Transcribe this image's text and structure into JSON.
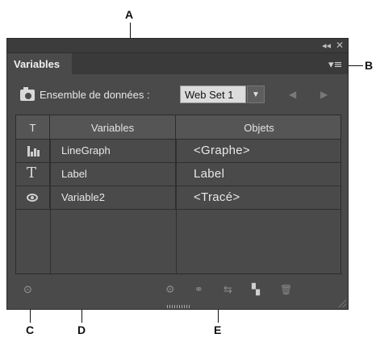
{
  "callouts": {
    "a": "A",
    "b": "B",
    "c": "C",
    "d": "D",
    "e": "E"
  },
  "panel": {
    "tab_label": "Variables",
    "collapse_glyph": "◂◂",
    "close_glyph": "✕",
    "menu_glyph": "▾≡"
  },
  "dataset": {
    "label": "Ensemble de données :",
    "selected": "Web Set 1",
    "dropdown_glyph": "▼",
    "prev_glyph": "◀",
    "next_glyph": "▶"
  },
  "table": {
    "headers": {
      "type": "T",
      "variables": "Variables",
      "objects": "Objets"
    },
    "rows": [
      {
        "type_icon": "graph-icon",
        "variable": "LineGraph",
        "object": "<Graphe>"
      },
      {
        "type_icon": "text-icon",
        "type_glyph": "T",
        "variable": "Label",
        "object": "Label"
      },
      {
        "type_icon": "visibility-icon",
        "variable": "Variable2",
        "object": "<Tracé>"
      }
    ]
  },
  "bottom_toolbar": {
    "capture_glyph": "⊙",
    "make_dynamic_glyph": "⚙",
    "make_visibility_glyph": "⚭",
    "unbind_glyph": "⇆",
    "new_variable_glyph": "▚",
    "delete_glyph": "🗑"
  },
  "colors": {
    "panel_bg": "#4a4a4a",
    "header_bg": "#555555",
    "select_bg": "#dcdcdc",
    "text": "#e8e8e8"
  }
}
